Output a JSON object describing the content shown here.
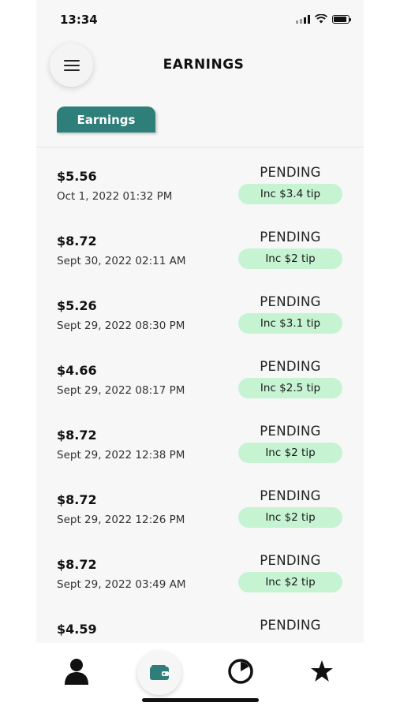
{
  "status_bar": {
    "time": "13:34"
  },
  "header": {
    "title": "EARNINGS",
    "menu_icon": "hamburger-icon"
  },
  "tabs": [
    {
      "label": "Earnings",
      "active": true
    }
  ],
  "earnings": [
    {
      "amount": "$5.56",
      "date": "Oct 1, 2022 01:32 PM",
      "status": "PENDING",
      "tip": "Inc $3.4 tip"
    },
    {
      "amount": "$8.72",
      "date": "Sept 30, 2022 02:11 AM",
      "status": "PENDING",
      "tip": "Inc $2 tip"
    },
    {
      "amount": "$5.26",
      "date": "Sept 29, 2022 08:30 PM",
      "status": "PENDING",
      "tip": "Inc $3.1 tip"
    },
    {
      "amount": "$4.66",
      "date": "Sept 29, 2022 08:17 PM",
      "status": "PENDING",
      "tip": "Inc $2.5 tip"
    },
    {
      "amount": "$8.72",
      "date": "Sept 29, 2022 12:38 PM",
      "status": "PENDING",
      "tip": "Inc $2 tip"
    },
    {
      "amount": "$8.72",
      "date": "Sept 29, 2022 12:26 PM",
      "status": "PENDING",
      "tip": "Inc $2 tip"
    },
    {
      "amount": "$8.72",
      "date": "Sept 29, 2022 03:49 AM",
      "status": "PENDING",
      "tip": "Inc $2 tip"
    },
    {
      "amount": "$4.59",
      "date": "",
      "status": "PENDING",
      "tip": ""
    }
  ],
  "bottom_nav": [
    {
      "icon": "person-icon"
    },
    {
      "icon": "wallet-icon",
      "active": true
    },
    {
      "icon": "pie-chart-icon"
    },
    {
      "icon": "star-icon"
    }
  ],
  "colors": {
    "accent": "#2e7e7a",
    "tip_pill": "#c6f3d2",
    "background": "#f7f7f7"
  }
}
